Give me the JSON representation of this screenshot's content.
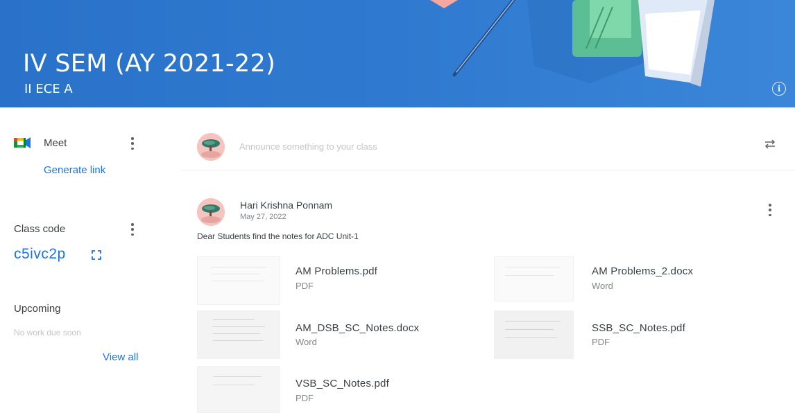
{
  "banner": {
    "title": "IV SEM (AY 2021-22)",
    "subtitle": "II ECE A",
    "background_color": "#2f7ad0",
    "info_icon": "info-icon"
  },
  "meet": {
    "label": "Meet",
    "generate_link": "Generate link",
    "icon": "google-meet-icon"
  },
  "class_code": {
    "label": "Class code",
    "value": "c5ivc2p",
    "icon": "fullscreen-icon"
  },
  "upcoming": {
    "label": "Upcoming",
    "empty_text": "No work due soon",
    "view_all": "View all"
  },
  "stream": {
    "announce_placeholder": "Announce something to your class",
    "repost_icon": "repost-icon",
    "post": {
      "author": "Hari Krishna Ponnam",
      "date": "May 27, 2022",
      "text": "Dear Students find the notes for ADC Unit-1",
      "attachments": [
        {
          "name": "AM Problems.pdf",
          "type": "PDF"
        },
        {
          "name": "AM Problems_2.docx",
          "type": "Word"
        },
        {
          "name": "AM_DSB_SC_Notes.docx",
          "type": "Word"
        },
        {
          "name": "SSB_SC_Notes.pdf",
          "type": "PDF"
        },
        {
          "name": "VSB_SC_Notes.pdf",
          "type": "PDF"
        }
      ]
    }
  },
  "colors": {
    "accent": "#1a73e8",
    "text": "#3c4043",
    "muted": "#80868b"
  }
}
